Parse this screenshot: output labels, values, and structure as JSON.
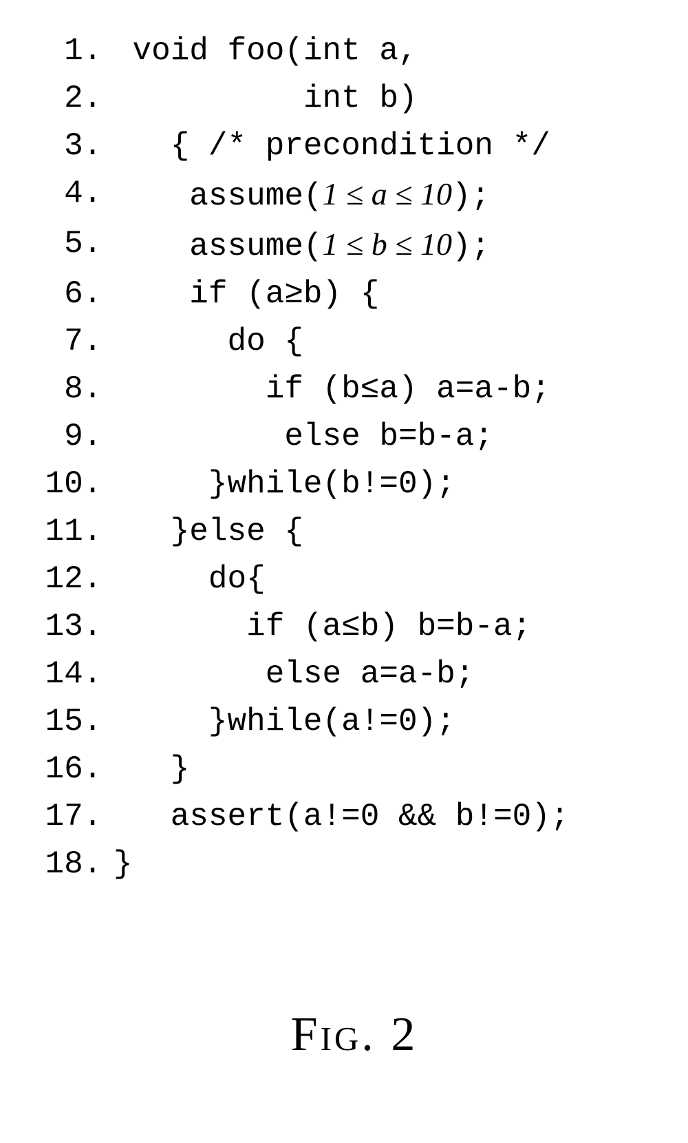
{
  "lines": [
    {
      "n": "1.",
      "code_pre": " void foo(int a,",
      "math": "",
      "code_post": ""
    },
    {
      "n": "2.",
      "code_pre": "          int b)",
      "math": "",
      "code_post": ""
    },
    {
      "n": "3.",
      "code_pre": "   { /* precondition */",
      "math": "",
      "code_post": ""
    },
    {
      "n": "4.",
      "code_pre": "    assume(",
      "math": "1 ≤ a ≤ 10",
      "code_post": ");"
    },
    {
      "n": "5.",
      "code_pre": "    assume(",
      "math": "1 ≤ b ≤ 10",
      "code_post": ");"
    },
    {
      "n": "6.",
      "code_pre": "    if (a≥b) {",
      "math": "",
      "code_post": ""
    },
    {
      "n": "7.",
      "code_pre": "      do {",
      "math": "",
      "code_post": ""
    },
    {
      "n": "8.",
      "code_pre": "        if (b≤a) a=a-b;",
      "math": "",
      "code_post": ""
    },
    {
      "n": "9.",
      "code_pre": "         else b=b-a;",
      "math": "",
      "code_post": ""
    },
    {
      "n": "10.",
      "code_pre": "     }while(b!=0);",
      "math": "",
      "code_post": ""
    },
    {
      "n": "11.",
      "code_pre": "   }else {",
      "math": "",
      "code_post": ""
    },
    {
      "n": "12.",
      "code_pre": "     do{",
      "math": "",
      "code_post": ""
    },
    {
      "n": "13.",
      "code_pre": "       if (a≤b) b=b-a;",
      "math": "",
      "code_post": ""
    },
    {
      "n": "14.",
      "code_pre": "        else a=a-b;",
      "math": "",
      "code_post": ""
    },
    {
      "n": "15.",
      "code_pre": "     }while(a!=0);",
      "math": "",
      "code_post": ""
    },
    {
      "n": "16.",
      "code_pre": "   }",
      "math": "",
      "code_post": ""
    },
    {
      "n": "17.",
      "code_pre": "   assert(a!=0 && b!=0);",
      "math": "",
      "code_post": ""
    },
    {
      "n": "18.",
      "code_pre": "}",
      "math": "",
      "code_post": ""
    }
  ],
  "caption_prefix": "Fig. ",
  "caption_number": "2"
}
